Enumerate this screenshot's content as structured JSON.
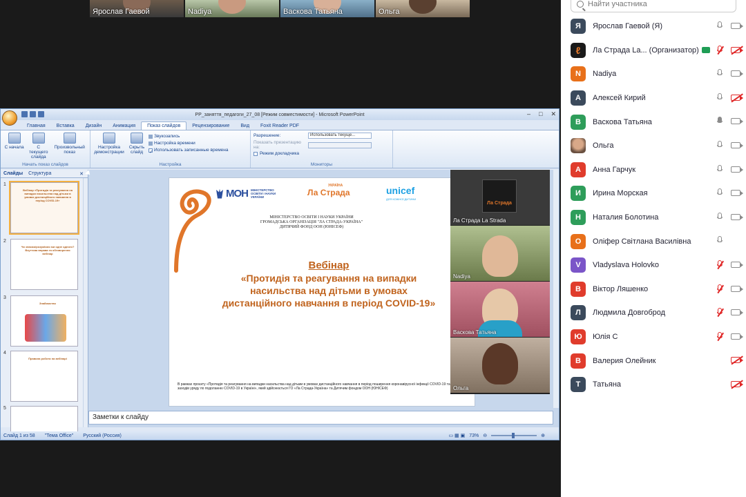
{
  "gallery_strip": [
    {
      "name": "Ярослав Гаевой"
    },
    {
      "name": "Nadiya"
    },
    {
      "name": "Васкова Татьяна"
    },
    {
      "name": "Ольга"
    }
  ],
  "ppt": {
    "window_title": "PP_заняття_педагоги_27_08 [Режим совместимости] - Microsoft PowerPoint",
    "tabs": [
      "Главная",
      "Вставка",
      "Дизайн",
      "Анимация",
      "Показ слайдов",
      "Рецензирование",
      "Вид",
      "Foxit Reader PDF"
    ],
    "active_tab": "Показ слайдов",
    "ribbon": {
      "group1_label": "Начать показ слайдов",
      "from_start": "С начала",
      "from_current": "С текущего слайда",
      "custom_show": "Произвольный показ",
      "group2_label": "Настройка",
      "setup": "Настройка демонстрации",
      "hide_slide": "Скрыть слайд",
      "record": "Звукозапись",
      "rehearse": "Настройка времени",
      "use_timings": "Использовать записанные времена",
      "group3_label": "Мониторы",
      "resolution_label": "Разрешение:",
      "resolution_value": "Использовать текуще...",
      "show_on_label": "Показать презентацию на:",
      "presenter_view": "Режим докладчика"
    },
    "slides_tab": "Слайды",
    "outline_tab": "Структура",
    "thumbnails": [
      {
        "num": "1",
        "text": "Вебінар «Протидія та реагування на випадки насильства над дітьми в умовах дистанційного навчання в період COVID-19»"
      },
      {
        "num": "2",
        "text": "Чи знаємо/розуміємо ми одне одного? Взуттєва вправа та обговорення вебінар"
      },
      {
        "num": "3",
        "text": "Знайомство"
      },
      {
        "num": "4",
        "text": "Правила роботи на вебінарі"
      },
      {
        "num": "5",
        "text": ""
      }
    ],
    "slide": {
      "ministry": "МІНІСТЕРСТВО ОСВІТИ І НАУКИ УКРАЇНИ",
      "ministry_logo": "МОН",
      "lastrada_small": "УКРАЇНА",
      "lastrada": "Ла Страда",
      "unicef": "unicef",
      "unicef_sub": "ДЛЯ КОЖНОЇ ДИТИНИ",
      "org_line1": "МІНІСТЕРСТВО ОСВІТИ І НАУКИ УКРАЇНИ",
      "org_line2": "ГРОМАДСЬКА ОРГАНІЗАЦІЯ \"ЛА СТРАДА-УКРАЇНА\"",
      "org_line3": "ДИТЯЧИЙ ФОНД ООН (ЮНІСЕФ)",
      "webinar": "Вебінар",
      "title_line1": "«Протидія та реагування на випадки",
      "title_line2": "насильства над дітьми в умовах",
      "title_line3": "дистанційного навчання в період COVID-19»",
      "note": "В рамках проєкту «Протидія та реагування на випадки насильства над дітьми в умовах дистанційного навчання в період поширення коронавірусної інфекції COVID-19 та заходів уряду по подоланню COVID-19 в Україні», який здійснюється ГО «Ла Страда-Україна» та Дитячим фондом ООН (ЮНІСЕФ)"
    },
    "video_tiles": [
      {
        "name": "Ла Страда La Strada",
        "logo": "Ла Страда"
      },
      {
        "name": "Nadiya"
      },
      {
        "name": "Васкова Татьяна"
      },
      {
        "name": "Ольга"
      }
    ],
    "notes_placeholder": "Заметки к слайду",
    "status": {
      "slide_of": "Слайд 1 из 58",
      "theme": "\"Тема Office\"",
      "language": "Русский (Россия)",
      "zoom": "73%"
    }
  },
  "participants": {
    "search_placeholder": "Найти участника",
    "list": [
      {
        "initial": "Я",
        "name": "Ярослав Гаевой (Я)",
        "color": "#3b4a5c",
        "mic": "on",
        "cam": "on"
      },
      {
        "initial": "",
        "name": "Ла Страда La... (Организатор)",
        "color": "#e0762a",
        "mic": "muted",
        "cam": "off",
        "host": true
      },
      {
        "initial": "N",
        "name": "Nadiya",
        "color": "#e8701a",
        "mic": "on",
        "cam": "on"
      },
      {
        "initial": "А",
        "name": "Алексей Кирий",
        "color": "#3b4a5c",
        "mic": "on",
        "cam": "off"
      },
      {
        "initial": "В",
        "name": "Васкова Татьяна",
        "color": "#2e9d5a",
        "mic": "talk",
        "cam": "on"
      },
      {
        "initial": "",
        "name": "Ольга",
        "color": "#b08060",
        "mic": "on",
        "cam": "on"
      },
      {
        "initial": "А",
        "name": "Анна Гарчук",
        "color": "#e03c2c",
        "mic": "on",
        "cam": "on"
      },
      {
        "initial": "И",
        "name": "Ирина Морская",
        "color": "#2e9d5a",
        "mic": "on",
        "cam": "on"
      },
      {
        "initial": "Н",
        "name": "Наталия Болотина",
        "color": "#2e9d5a",
        "mic": "on",
        "cam": "on"
      },
      {
        "initial": "О",
        "name": "Оліфер Світлана Василівна",
        "color": "#e8701a",
        "mic": "on",
        "cam": "none"
      },
      {
        "initial": "V",
        "name": "Vladyslava Holovko",
        "color": "#7b55c8",
        "mic": "muted",
        "cam": "on"
      },
      {
        "initial": "В",
        "name": "Віктор Ляшенко",
        "color": "#e03c2c",
        "mic": "muted",
        "cam": "on"
      },
      {
        "initial": "Л",
        "name": "Людмила Довгоброд",
        "color": "#3b4a5c",
        "mic": "muted",
        "cam": "on"
      },
      {
        "initial": "Ю",
        "name": "Юлія С",
        "color": "#e03c2c",
        "mic": "muted",
        "cam": "on"
      },
      {
        "initial": "В",
        "name": "Валерия Олейник",
        "color": "#e03c2c",
        "mic": "none",
        "cam": "off"
      },
      {
        "initial": "Т",
        "name": "Татьяна",
        "color": "#3b4a5c",
        "mic": "none",
        "cam": "off"
      }
    ]
  }
}
